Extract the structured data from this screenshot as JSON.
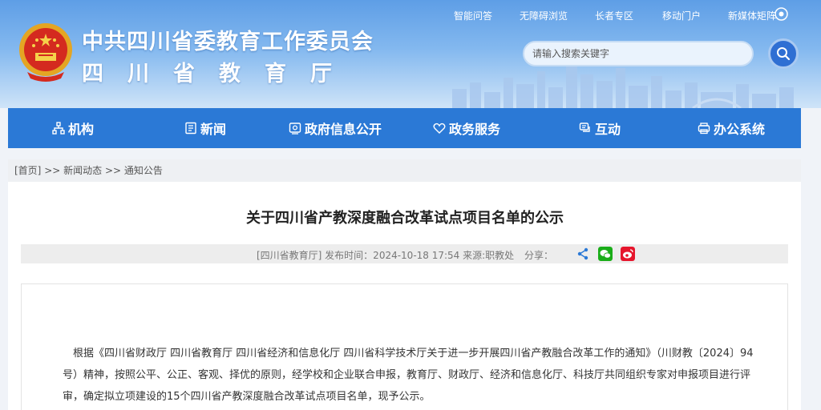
{
  "header": {
    "title_main": "中共四川省委教育工作委员会",
    "title_sub": "四川省教育厅",
    "top_links": [
      "智能问答",
      "无障碍浏览",
      "长者专区",
      "移动门户",
      "新媒体矩阵"
    ],
    "search_placeholder": "请输入搜索关键字"
  },
  "nav": {
    "items": [
      {
        "label": "机构",
        "icon": "org-icon"
      },
      {
        "label": "新闻",
        "icon": "news-icon"
      },
      {
        "label": "政府信息公开",
        "icon": "info-icon"
      },
      {
        "label": "政务服务",
        "icon": "service-icon"
      },
      {
        "label": "互动",
        "icon": "chat-icon"
      },
      {
        "label": "办公系统",
        "icon": "office-icon"
      }
    ]
  },
  "breadcrumb": {
    "home": "[首页]",
    "sep1": " >> ",
    "level1": "新闻动态",
    "sep2": " >> ",
    "level2": "通知公告"
  },
  "article": {
    "title": "关于四川省产教深度融合改革试点项目名单的公示",
    "meta": "[四川省教育厅]   发布时间：2024-10-18 17:54   来源:职教处",
    "share_label": "分享：",
    "paragraph": "根据《四川省财政厅 四川省教育厅 四川省经济和信息化厅 四川省科学技术厅关于进一步开展四川省产教融合改革工作的通知》（川财教〔2024〕94号）精神，按照公平、公正、客观、择优的原则，经学校和企业联合申报，教育厅、财政厅、经济和信息化厅、科技厅共同组织专家对申报项目进行评审，确定拟立项建设的15个四川省产教深度融合改革试点项目名单，现予公示。"
  },
  "colors": {
    "nav_bg": "#2b79d6",
    "header_top": "#5e9ee6",
    "wechat": "#1aad19",
    "weibo": "#e6162d",
    "share_blue": "#2b79d6"
  }
}
